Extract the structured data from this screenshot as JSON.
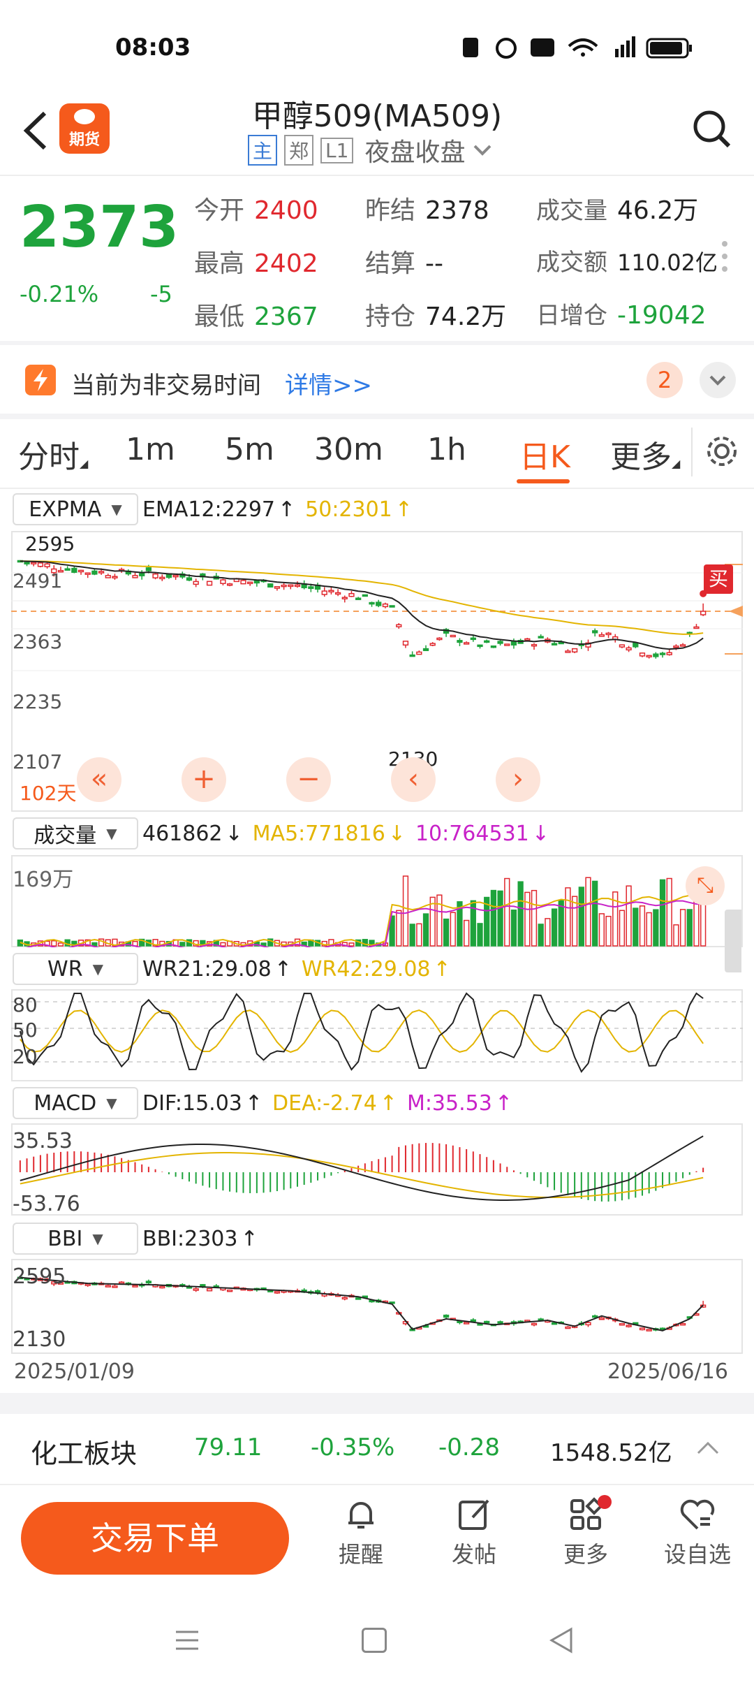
{
  "status_bar": {
    "time": "08:03"
  },
  "header": {
    "title": "甲醇509(MA509)",
    "badge_logo": "期货",
    "tag1": "主",
    "tag2": "郑",
    "tag3": "L1",
    "session": "夜盘收盘"
  },
  "quote": {
    "price": "2373",
    "change_pct": "-0.21%",
    "change": "-5",
    "fields": [
      {
        "label": "今开",
        "value": "2400",
        "color": "#e0282e"
      },
      {
        "label": "昨结",
        "value": "2378",
        "color": "#222222"
      },
      {
        "label": "成交量",
        "value": "46.2万",
        "color": "#222222"
      },
      {
        "label": "最高",
        "value": "2402",
        "color": "#e0282e"
      },
      {
        "label": "结算",
        "value": "--",
        "color": "#222222"
      },
      {
        "label": "成交额",
        "value": "110.02亿",
        "color": "#222222"
      },
      {
        "label": "最低",
        "value": "2367",
        "color": "#1ea33c"
      },
      {
        "label": "持仓",
        "value": "74.2万",
        "color": "#222222"
      },
      {
        "label": "日增仓",
        "value": "-19042",
        "color": "#1ea33c"
      }
    ]
  },
  "notice": {
    "text": "当前为非交易时间",
    "link": "详情>>",
    "count": "2"
  },
  "tabs": [
    "分时",
    "1m",
    "5m",
    "30m",
    "1h",
    "日K",
    "更多"
  ],
  "active_tab": "日K",
  "expma": {
    "selector": "EXPMA",
    "ema12": "EMA12:2297",
    "ema50": "50:2301",
    "axis": [
      "2595",
      "2491",
      "2363",
      "2235",
      "2107"
    ],
    "low_label": "2130",
    "days": "102天",
    "buy": "买"
  },
  "volume": {
    "selector": "成交量",
    "value": "461862",
    "ma5": "MA5:771816",
    "ma10": "10:764531",
    "axis_top": "169万"
  },
  "wr": {
    "selector": "WR",
    "wr21": "WR21:29.08",
    "wr42": "WR42:29.08",
    "axis": [
      "80",
      "50",
      "20"
    ]
  },
  "macd": {
    "selector": "MACD",
    "dif": "DIF:15.03",
    "dea": "DEA:-2.74",
    "m": "M:35.53",
    "axis_top": "35.53",
    "axis_bottom": "-53.76"
  },
  "bbi": {
    "selector": "BBI",
    "value": "BBI:2303",
    "axis_top": "2595",
    "axis_bottom": "2130"
  },
  "dates": {
    "start": "2025/01/09",
    "end": "2025/06/16"
  },
  "sector": {
    "name": "化工板块",
    "price": "79.11",
    "pct": "-0.35%",
    "change": "-0.28",
    "amount": "1548.52亿"
  },
  "bottom_nav": {
    "trade": "交易下单",
    "remind": "提醒",
    "post": "发帖",
    "more": "更多",
    "fav": "设自选"
  },
  "colors": {
    "up": "#e0282e",
    "down": "#1ea33c",
    "accent": "#f55a1c",
    "ema50": "#e3b400",
    "ma10": "#c822c8"
  }
}
